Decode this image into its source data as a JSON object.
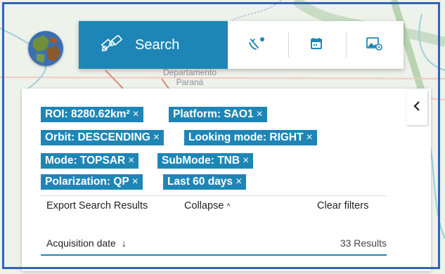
{
  "map": {
    "region_label": "Departamento\nParaná"
  },
  "toolbar": {
    "search_label": "Search",
    "icons": [
      "search-satellite-icon",
      "satellite-dish-icon",
      "calendar-icon",
      "image-settings-icon"
    ]
  },
  "filters": [
    {
      "label": "ROI: 8280.62km²",
      "remove": "×"
    },
    {
      "label": "Platform: SAO1",
      "remove": "×"
    },
    {
      "label": "Orbit: DESCENDING",
      "remove": "×"
    },
    {
      "label": "Looking mode: RIGHT",
      "remove": "×"
    },
    {
      "label": "Mode: TOPSAR",
      "remove": "×"
    },
    {
      "label": "SubMode: TNB",
      "remove": "×"
    },
    {
      "label": "Polarization: QP",
      "remove": "×"
    },
    {
      "label": "Last 60 days",
      "remove": "×"
    }
  ],
  "actions": {
    "export": "Export Search Results",
    "collapse": "Collapse",
    "clear": "Clear filters"
  },
  "results": {
    "sort_label": "Acquisition date",
    "count_text": "33 Results"
  },
  "colors": {
    "accent": "#1e86b6",
    "frame": "#2f64b8"
  }
}
